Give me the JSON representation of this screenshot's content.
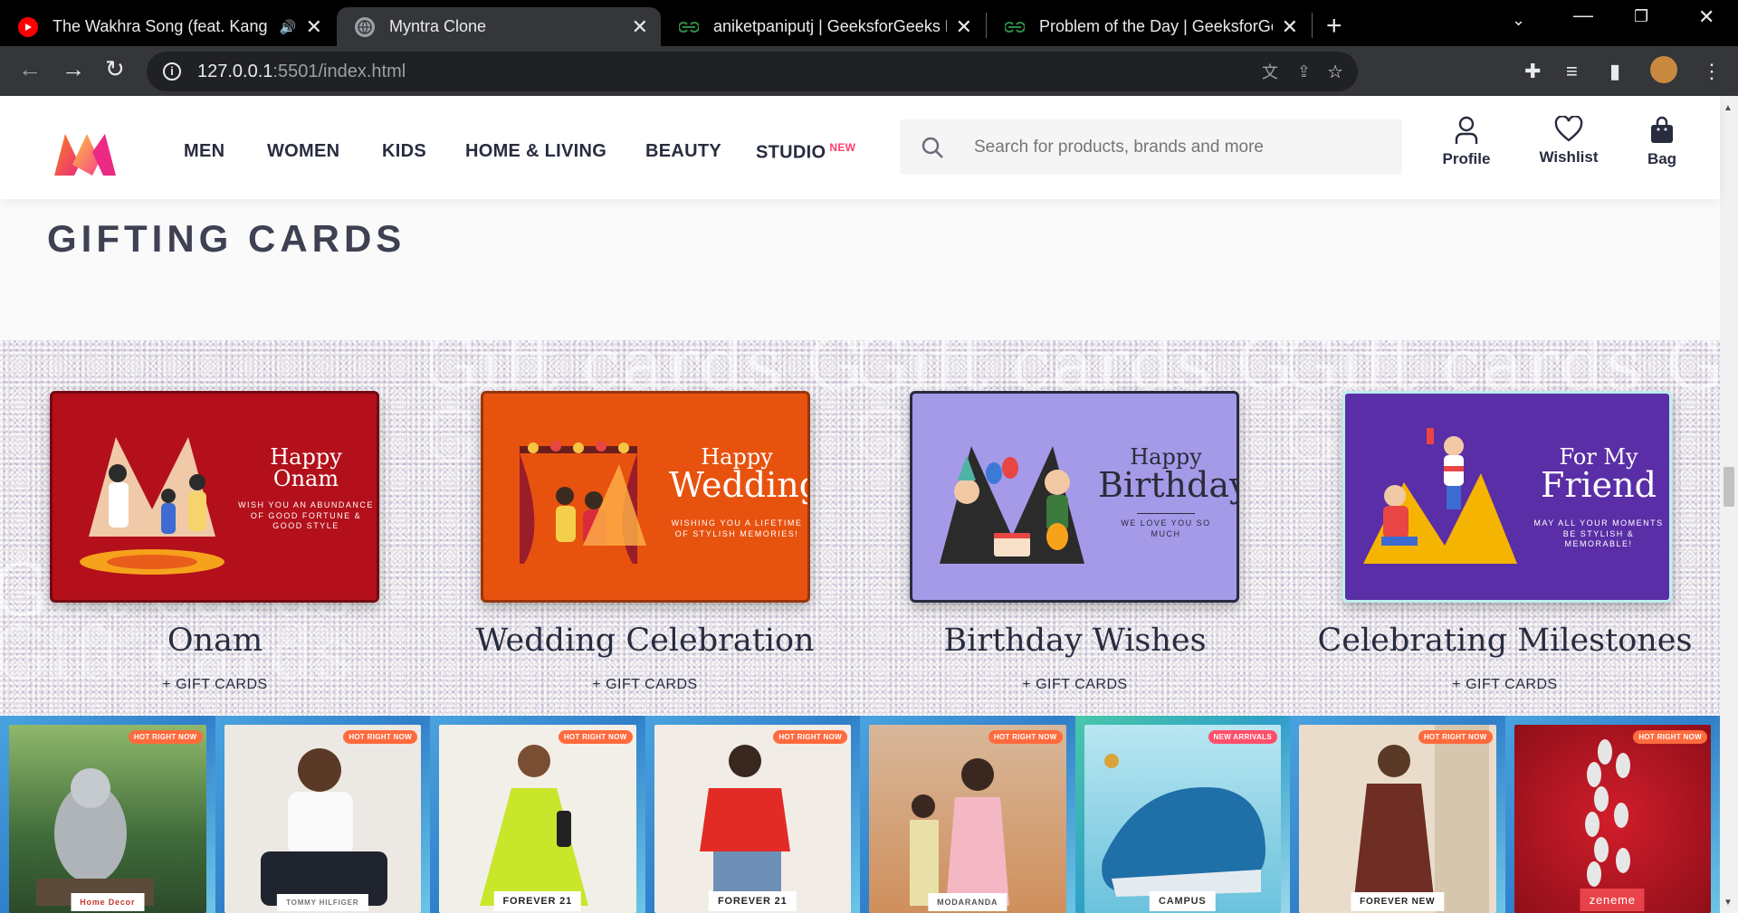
{
  "browser": {
    "tabs": [
      {
        "title": "The Wakhra Song (feat. Kang",
        "favicon": "youtube-icon",
        "audio": true
      },
      {
        "title": "Myntra Clone",
        "favicon": "globe-icon",
        "active": true
      },
      {
        "title": "aniketpaniputj | GeeksforGeeks P",
        "favicon": "gfg-icon"
      },
      {
        "title": "Problem of the Day | GeeksforGe",
        "favicon": "gfg-icon"
      }
    ],
    "url_host": "127.0.0.1",
    "url_rest": ":5501/index.html"
  },
  "header": {
    "nav": [
      "MEN",
      "WOMEN",
      "KIDS",
      "HOME & LIVING",
      "BEAUTY",
      "STUDIO"
    ],
    "studio_badge": "NEW",
    "search_placeholder": "Search for products, brands and more",
    "actions": {
      "profile": "Profile",
      "wishlist": "Wishlist",
      "bag": "Bag"
    },
    "brand_colors": {
      "accent": "#ff3f6c",
      "logo_orange": "#f7841a",
      "logo_pink": "#ec2a83"
    }
  },
  "gifting": {
    "heading": "GIFTING CARDS",
    "cards": [
      {
        "name": "Onam",
        "sub": "+ GIFT CARDS",
        "card_l1": "Happy Onam",
        "card_l2": "",
        "card_tag": "WISH YOU AN ABUNDANCE OF GOOD FORTUNE & GOOD STYLE",
        "color": "#b3101b"
      },
      {
        "name": "Wedding Celebration",
        "sub": "+ GIFT CARDS",
        "card_l1": "Happy",
        "card_l2": "Wedding",
        "card_tag": "WISHING YOU A LIFETIME OF STYLISH MEMORIES!",
        "color": "#e8520f"
      },
      {
        "name": "Birthday Wishes",
        "sub": "+ GIFT CARDS",
        "card_l1": "Happy",
        "card_l2": "Birthday",
        "card_tag": "WE LOVE YOU SO MUCH",
        "color": "#a59ae8"
      },
      {
        "name": "Celebrating Milestones",
        "sub": "+ GIFT CARDS",
        "card_l1": "For My",
        "card_l2": "Friend",
        "card_tag": "MAY ALL YOUR MOMENTS BE STYLISH & MEMORABLE!",
        "color": "#5a2ea6"
      }
    ]
  },
  "products": [
    {
      "badge": "HOT RIGHT NOW",
      "brand": "Home Decor",
      "bg": "#3f6b3a"
    },
    {
      "badge": "HOT RIGHT NOW",
      "brand": "TOMMY HILFIGER",
      "bg": "#ece8e3"
    },
    {
      "badge": "HOT RIGHT NOW",
      "brand": "FOREVER 21",
      "bg": "#f2efe8"
    },
    {
      "badge": "HOT RIGHT NOW",
      "brand": "FOREVER 21",
      "bg": "#f1ede6"
    },
    {
      "badge": "HOT RIGHT NOW",
      "brand": "MODARANDA",
      "bg": "#cf8f5c"
    },
    {
      "badge": "NEW ARRIVALS",
      "brand": "CAMPUS",
      "bg": "#8fd3e8"
    },
    {
      "badge": "HOT RIGHT NOW",
      "brand": "FOREVER NEW",
      "bg": "#e9dccb"
    },
    {
      "badge": "HOT RIGHT NOW",
      "brand": "zeneme",
      "bg": "#b5121f"
    }
  ]
}
